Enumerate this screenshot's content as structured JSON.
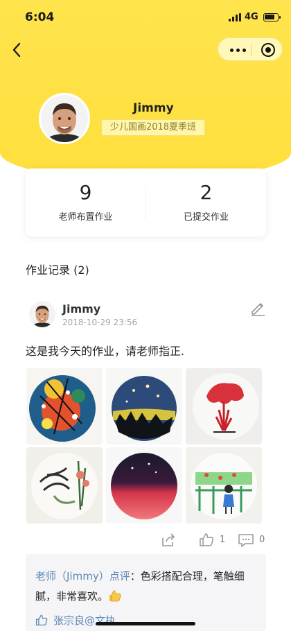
{
  "status_bar": {
    "time": "6:04",
    "network": "4G"
  },
  "profile": {
    "name": "Jimmy",
    "class_name": "少儿国画2018夏季班",
    "avatar_icon": "avatar-photo"
  },
  "stats": [
    {
      "value": "9",
      "label": "老师布置作业"
    },
    {
      "value": "2",
      "label": "已提交作业"
    }
  ],
  "records": {
    "title": "作业记录 (2)"
  },
  "post": {
    "author": "Jimmy",
    "time": "2018-10-29 23:56",
    "text": "这是我今天的作业，请老师指正.",
    "images": [
      "painting-splatter-circle",
      "painting-night-circle",
      "painting-red-flower",
      "painting-ink-plants",
      "painting-red-gradient-circle",
      "painting-girl-fence"
    ],
    "like_count": "1",
    "comment_count": "0"
  },
  "review": {
    "reviewer": "老师（Jimmy）点评",
    "text": "：色彩搭配合理，笔触细腻，非常喜欢。",
    "likers": "张宗良@文执"
  },
  "colors": {
    "header_yellow": "#ffe144",
    "link_blue": "#5b87b5",
    "review_bg": "#f5f5f7"
  }
}
